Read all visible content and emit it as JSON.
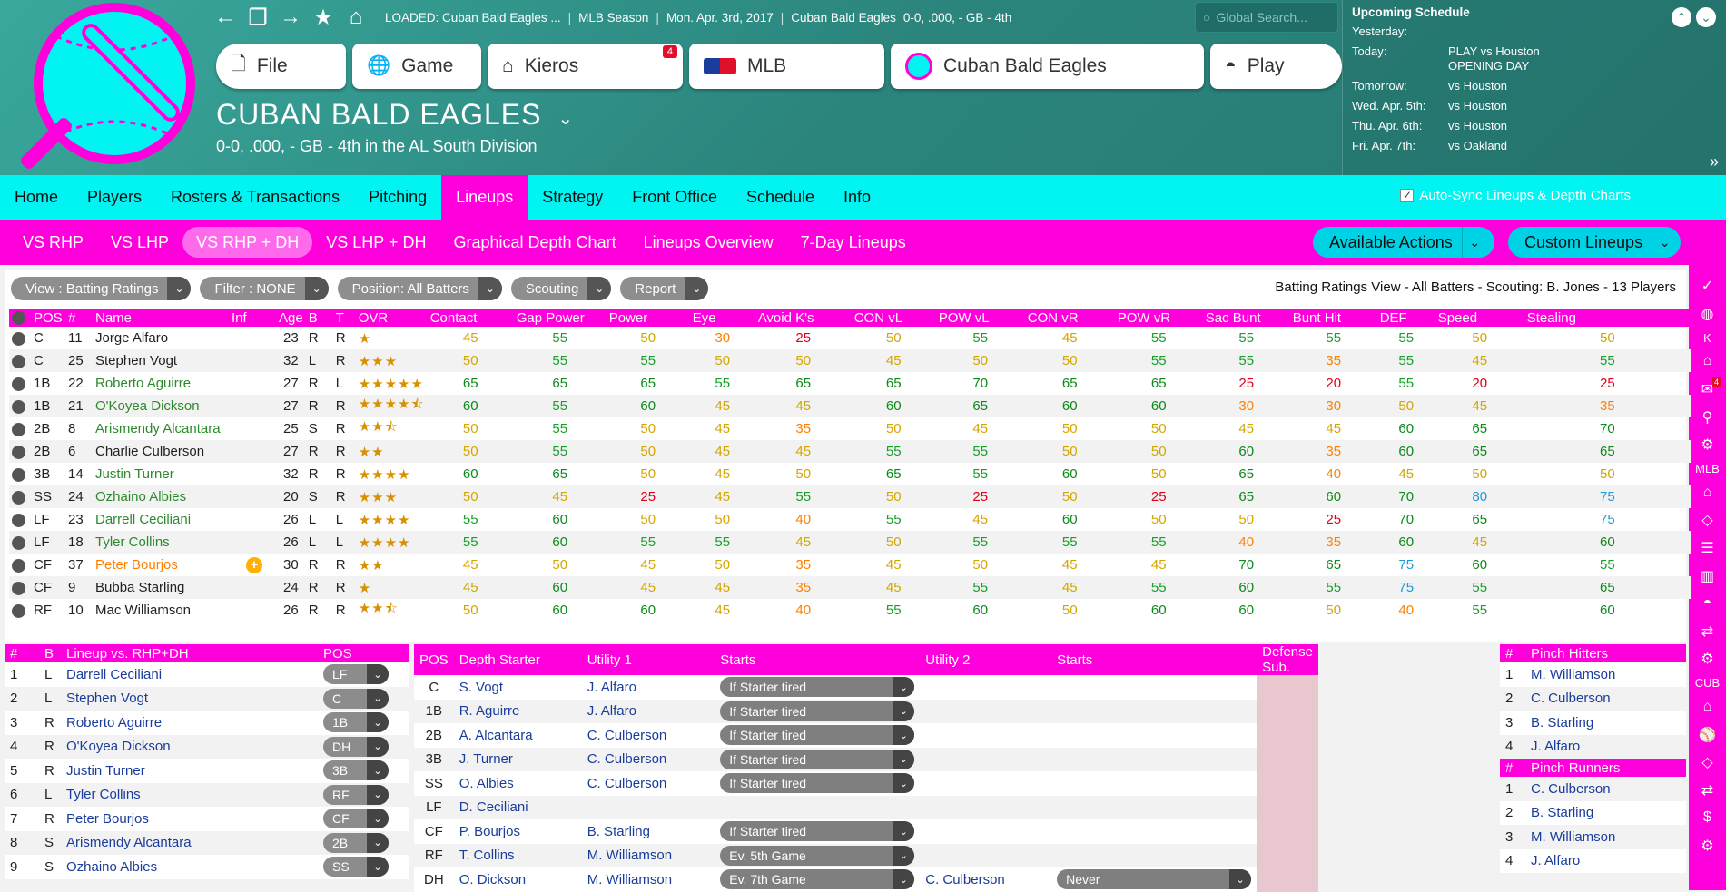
{
  "topbar": {
    "loaded": "LOADED: Cuban Bald Eagles ...",
    "season": "MLB Season",
    "date": "Mon. Apr. 3rd, 2017",
    "team": "Cuban Bald Eagles",
    "record": "0-0, .000, - GB - 4th",
    "search_placeholder": "Global Search..."
  },
  "menu": [
    {
      "label": "File",
      "icon": "file-icon"
    },
    {
      "label": "Game",
      "icon": "globe-icon"
    },
    {
      "label": "Kieros",
      "icon": "home-icon",
      "badge": "4"
    },
    {
      "label": "MLB",
      "icon": "mlb-logo-icon"
    },
    {
      "label": "Cuban Bald Eagles",
      "icon": "team-logo-icon"
    },
    {
      "label": "Play",
      "icon": "baseball-icon"
    }
  ],
  "team_header": {
    "title": "CUBAN BALD EAGLES",
    "subtitle": "0-0, .000, - GB - 4th in the AL South Division"
  },
  "schedule": {
    "title": "Upcoming Schedule",
    "rows": [
      {
        "day": "Yesterday:",
        "game": ""
      },
      {
        "day": "Today:",
        "game": "PLAY vs Houston",
        "game2": "OPENING DAY"
      },
      {
        "day": "Tomorrow:",
        "game": "vs Houston"
      },
      {
        "day": "Wed. Apr. 5th:",
        "game": "vs Houston"
      },
      {
        "day": "Thu. Apr. 6th:",
        "game": "vs Houston"
      },
      {
        "day": "Fri. Apr. 7th:",
        "game": "vs Oakland"
      }
    ]
  },
  "tabs1": [
    "Home",
    "Players",
    "Rosters & Transactions",
    "Pitching",
    "Lineups",
    "Strategy",
    "Front Office",
    "Schedule",
    "Info"
  ],
  "tabs1_active": 4,
  "autosync_label": "Auto-Sync Lineups & Depth Charts",
  "tabs2": [
    "VS RHP",
    "VS LHP",
    "VS RHP + DH",
    "VS LHP + DH",
    "Graphical Depth Chart",
    "Lineups Overview",
    "7-Day Lineups"
  ],
  "tabs2_active": 2,
  "actions": {
    "available": "Available Actions",
    "custom": "Custom Lineups"
  },
  "filters": [
    "View : Batting Ratings",
    "Filter : NONE",
    "Position: All Batters",
    "Scouting",
    "Report"
  ],
  "view_info": "Batting Ratings View - All Batters - Scouting: B. Jones - 13 Players",
  "ratings_headers": [
    "POS",
    "#",
    "Name",
    "Inf",
    "Age",
    "B",
    "T",
    "OVR",
    "Contact",
    "Gap Power",
    "Power",
    "Eye",
    "Avoid K's",
    "CON vL",
    "POW vL",
    "CON vR",
    "POW vR",
    "Sac Bunt",
    "Bunt Hit",
    "DEF",
    "Speed",
    "Stealing"
  ],
  "players": [
    {
      "pos": "C",
      "num": "11",
      "name": "Jorge Alfaro",
      "inf": "",
      "age": "23",
      "b": "R",
      "t": "R",
      "ovr": "★",
      "v": [
        "45",
        "55",
        "50",
        "30",
        "25",
        "50",
        "55",
        "45",
        "55",
        "55",
        "55",
        "55",
        "50",
        "50"
      ],
      "nc": ""
    },
    {
      "pos": "C",
      "num": "25",
      "name": "Stephen Vogt",
      "inf": "",
      "age": "32",
      "b": "L",
      "t": "R",
      "ovr": "★★★",
      "v": [
        "50",
        "55",
        "55",
        "50",
        "50",
        "45",
        "50",
        "50",
        "55",
        "55",
        "35",
        "55",
        "45",
        "55"
      ],
      "nc": ""
    },
    {
      "pos": "1B",
      "num": "22",
      "name": "Roberto Aguirre",
      "inf": "",
      "age": "27",
      "b": "R",
      "t": "L",
      "ovr": "★★★★★",
      "v": [
        "65",
        "65",
        "65",
        "55",
        "65",
        "65",
        "70",
        "65",
        "65",
        "25",
        "20",
        "55",
        "20",
        "25"
      ],
      "nc": "green"
    },
    {
      "pos": "1B",
      "num": "21",
      "name": "O'Koyea Dickson",
      "inf": "",
      "age": "27",
      "b": "R",
      "t": "R",
      "ovr": "★★★★⯪",
      "v": [
        "60",
        "55",
        "60",
        "45",
        "45",
        "60",
        "65",
        "60",
        "60",
        "30",
        "30",
        "50",
        "45",
        "35"
      ],
      "nc": "green"
    },
    {
      "pos": "2B",
      "num": "8",
      "name": "Arismendy Alcantara",
      "inf": "",
      "age": "25",
      "b": "S",
      "t": "R",
      "ovr": "★★⯪",
      "v": [
        "50",
        "55",
        "50",
        "45",
        "35",
        "50",
        "45",
        "50",
        "50",
        "45",
        "45",
        "60",
        "65",
        "70"
      ],
      "nc": "green"
    },
    {
      "pos": "2B",
      "num": "6",
      "name": "Charlie Culberson",
      "inf": "",
      "age": "27",
      "b": "R",
      "t": "R",
      "ovr": "★★",
      "v": [
        "50",
        "55",
        "50",
        "45",
        "45",
        "55",
        "55",
        "50",
        "50",
        "60",
        "35",
        "60",
        "65",
        "65"
      ],
      "nc": ""
    },
    {
      "pos": "3B",
      "num": "14",
      "name": "Justin Turner",
      "inf": "",
      "age": "32",
      "b": "R",
      "t": "R",
      "ovr": "★★★★",
      "v": [
        "60",
        "65",
        "50",
        "45",
        "50",
        "65",
        "55",
        "60",
        "50",
        "65",
        "40",
        "45",
        "50",
        "50"
      ],
      "nc": "green"
    },
    {
      "pos": "SS",
      "num": "24",
      "name": "Ozhaino Albies",
      "inf": "",
      "age": "20",
      "b": "S",
      "t": "R",
      "ovr": "★★★",
      "v": [
        "50",
        "45",
        "25",
        "45",
        "55",
        "50",
        "25",
        "50",
        "25",
        "65",
        "60",
        "70",
        "80",
        "75"
      ],
      "nc": "green"
    },
    {
      "pos": "LF",
      "num": "23",
      "name": "Darrell Ceciliani",
      "inf": "",
      "age": "26",
      "b": "L",
      "t": "L",
      "ovr": "★★★★",
      "v": [
        "55",
        "60",
        "50",
        "50",
        "40",
        "55",
        "45",
        "60",
        "50",
        "50",
        "25",
        "70",
        "65",
        "75"
      ],
      "nc": "green"
    },
    {
      "pos": "LF",
      "num": "18",
      "name": "Tyler Collins",
      "inf": "",
      "age": "26",
      "b": "L",
      "t": "L",
      "ovr": "★★★★",
      "v": [
        "55",
        "60",
        "55",
        "55",
        "45",
        "50",
        "55",
        "55",
        "55",
        "40",
        "35",
        "60",
        "45",
        "60"
      ],
      "nc": "green"
    },
    {
      "pos": "CF",
      "num": "37",
      "name": "Peter Bourjos",
      "inf": "+",
      "age": "30",
      "b": "R",
      "t": "R",
      "ovr": "★★",
      "v": [
        "45",
        "50",
        "45",
        "50",
        "35",
        "45",
        "50",
        "45",
        "45",
        "70",
        "65",
        "75",
        "60",
        "55"
      ],
      "nc": "orange"
    },
    {
      "pos": "CF",
      "num": "9",
      "name": "Bubba Starling",
      "inf": "",
      "age": "24",
      "b": "R",
      "t": "R",
      "ovr": "★",
      "v": [
        "45",
        "60",
        "45",
        "45",
        "35",
        "45",
        "55",
        "45",
        "55",
        "60",
        "55",
        "75",
        "55",
        "65"
      ],
      "nc": ""
    },
    {
      "pos": "RF",
      "num": "10",
      "name": "Mac Williamson",
      "inf": "",
      "age": "26",
      "b": "R",
      "t": "R",
      "ovr": "★★⯪",
      "v": [
        "50",
        "60",
        "60",
        "45",
        "40",
        "55",
        "60",
        "50",
        "60",
        "60",
        "50",
        "40",
        "55",
        "60"
      ],
      "nc": ""
    }
  ],
  "lineup": {
    "headers": [
      "#",
      "B",
      "Lineup vs. RHP+DH",
      "POS"
    ],
    "rows": [
      {
        "n": "1",
        "b": "L",
        "name": "Darrell Ceciliani",
        "pos": "LF"
      },
      {
        "n": "2",
        "b": "L",
        "name": "Stephen Vogt",
        "pos": "C"
      },
      {
        "n": "3",
        "b": "R",
        "name": "Roberto Aguirre",
        "pos": "1B"
      },
      {
        "n": "4",
        "b": "R",
        "name": "O'Koyea Dickson",
        "pos": "DH"
      },
      {
        "n": "5",
        "b": "R",
        "name": "Justin Turner",
        "pos": "3B"
      },
      {
        "n": "6",
        "b": "L",
        "name": "Tyler Collins",
        "pos": "RF"
      },
      {
        "n": "7",
        "b": "R",
        "name": "Peter Bourjos",
        "pos": "CF"
      },
      {
        "n": "8",
        "b": "S",
        "name": "Arismendy Alcantara",
        "pos": "2B"
      },
      {
        "n": "9",
        "b": "S",
        "name": "Ozhaino Albies",
        "pos": "SS"
      }
    ]
  },
  "depth": {
    "headers": [
      "POS",
      "Depth Starter",
      "Utility 1",
      "Starts",
      "Utility 2",
      "Starts",
      "Defense Sub."
    ],
    "rows": [
      {
        "pos": "C",
        "starter": "S. Vogt",
        "u1": "J. Alfaro",
        "s1": "If Starter tired",
        "u2": "",
        "s2": ""
      },
      {
        "pos": "1B",
        "starter": "R. Aguirre",
        "u1": "J. Alfaro",
        "s1": "If Starter tired",
        "u2": "",
        "s2": ""
      },
      {
        "pos": "2B",
        "starter": "A. Alcantara",
        "u1": "C. Culberson",
        "s1": "If Starter tired",
        "u2": "",
        "s2": ""
      },
      {
        "pos": "3B",
        "starter": "J. Turner",
        "u1": "C. Culberson",
        "s1": "If Starter tired",
        "u2": "",
        "s2": ""
      },
      {
        "pos": "SS",
        "starter": "O. Albies",
        "u1": "C. Culberson",
        "s1": "If Starter tired",
        "u2": "",
        "s2": ""
      },
      {
        "pos": "LF",
        "starter": "D. Ceciliani",
        "u1": "",
        "s1": "",
        "u2": "",
        "s2": ""
      },
      {
        "pos": "CF",
        "starter": "P. Bourjos",
        "u1": "B. Starling",
        "s1": "If Starter tired",
        "u2": "",
        "s2": ""
      },
      {
        "pos": "RF",
        "starter": "T. Collins",
        "u1": "M. Williamson",
        "s1": "Ev. 5th Game",
        "u2": "",
        "s2": ""
      },
      {
        "pos": "DH",
        "starter": "O. Dickson",
        "u1": "M. Williamson",
        "s1": "Ev. 7th Game",
        "u2": "C. Culberson",
        "s2": "Never"
      }
    ]
  },
  "pinch_hitters": {
    "title": "Pinch Hitters",
    "rows": [
      {
        "n": "1",
        "name": "M. Williamson"
      },
      {
        "n": "2",
        "name": "C. Culberson"
      },
      {
        "n": "3",
        "name": "B. Starling"
      },
      {
        "n": "4",
        "name": "J. Alfaro"
      }
    ]
  },
  "pinch_runners": {
    "title": "Pinch Runners",
    "rows": [
      {
        "n": "1",
        "name": "C. Culberson"
      },
      {
        "n": "2",
        "name": "B. Starling"
      },
      {
        "n": "3",
        "name": "M. Williamson"
      },
      {
        "n": "4",
        "name": "J. Alfaro"
      }
    ]
  },
  "sidebar": {
    "k": "K",
    "badge": "4",
    "mlb": "MLB",
    "cub": "CUB"
  },
  "colors": {
    "magenta": "#ff00dc",
    "cyan": "#00f4f2",
    "teal": "#2b857d"
  }
}
